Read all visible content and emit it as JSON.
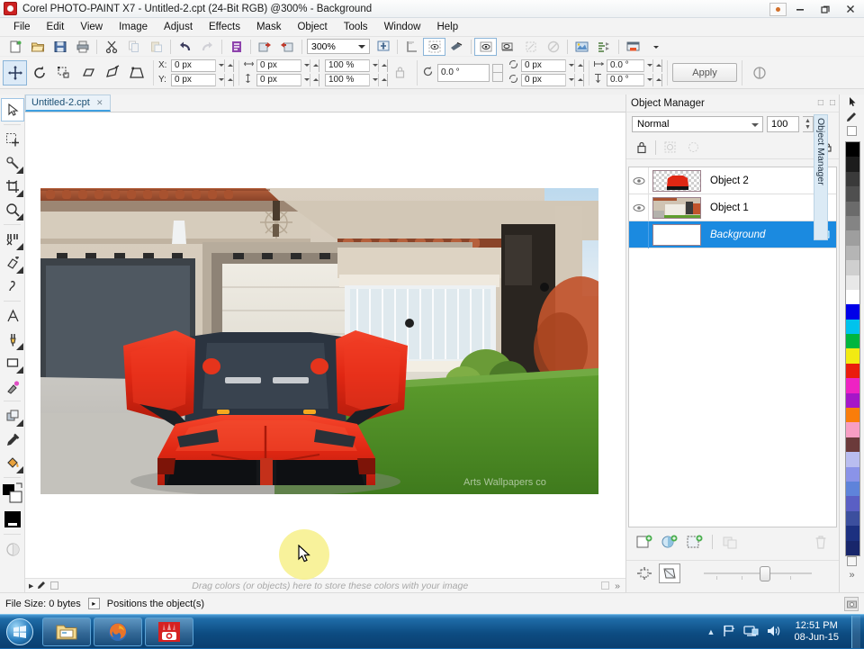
{
  "window": {
    "title": "Corel PHOTO-PAINT X7 - Untitled-2.cpt (24-Bit RGB) @300% - Background",
    "logo_icon": "corel-photopaint-logo",
    "account_icon": "user-account-icon",
    "minimize_label": "—",
    "restore_label": "❐",
    "close_label": "✕"
  },
  "menubar": {
    "items": [
      {
        "label": "File"
      },
      {
        "label": "Edit"
      },
      {
        "label": "View"
      },
      {
        "label": "Image"
      },
      {
        "label": "Adjust"
      },
      {
        "label": "Effects"
      },
      {
        "label": "Mask"
      },
      {
        "label": "Object"
      },
      {
        "label": "Tools"
      },
      {
        "label": "Window"
      },
      {
        "label": "Help"
      }
    ]
  },
  "toolbar": {
    "zoom_value": "300%",
    "items": [
      {
        "name": "new-document-button",
        "icon": "new-page-icon"
      },
      {
        "name": "open-button",
        "icon": "folder-open-icon"
      },
      {
        "name": "save-button",
        "icon": "floppy-disk-icon"
      },
      {
        "name": "print-button",
        "icon": "printer-icon"
      },
      {
        "name": "cut-button",
        "icon": "scissors-icon"
      },
      {
        "name": "copy-button",
        "icon": "copy-icon"
      },
      {
        "name": "paste-button",
        "icon": "paste-icon"
      },
      {
        "name": "undo-button",
        "icon": "undo-arrow-icon"
      },
      {
        "name": "redo-button",
        "icon": "redo-arrow-icon"
      },
      {
        "name": "import-button",
        "icon": "import-icon"
      },
      {
        "name": "export-button",
        "icon": "export-icon"
      },
      {
        "name": "export-to-web-button",
        "icon": "export-web-icon"
      },
      {
        "name": "zoom-levels-combo",
        "icon": "chevron-down-icon"
      },
      {
        "name": "fit-to-window-button",
        "icon": "fit-window-icon"
      },
      {
        "name": "full-screen-preview-button",
        "icon": "full-screen-icon"
      },
      {
        "name": "show-grid-button",
        "icon": "grid-icon"
      },
      {
        "name": "show-rulers-button",
        "icon": "ruler-icon"
      },
      {
        "name": "mask-overlay-button",
        "icon": "mask-overlay-icon"
      },
      {
        "name": "mask-marquee-button",
        "icon": "mask-marquee-icon"
      },
      {
        "name": "clip-mask-button",
        "icon": "clip-mask-icon"
      },
      {
        "name": "no-clip-button",
        "icon": "no-entry-icon"
      },
      {
        "name": "image-adjustment-lab-button",
        "icon": "adjust-lab-icon"
      },
      {
        "name": "object-manager-button",
        "icon": "layers-icon"
      },
      {
        "name": "application-launcher-button",
        "icon": "app-launcher-icon"
      },
      {
        "name": "launcher-dropdown-button",
        "icon": "chevron-down-icon"
      }
    ]
  },
  "propbar": {
    "tools": [
      {
        "name": "object-pick-tool",
        "icon": "move-cross-icon",
        "selected": true
      },
      {
        "name": "rotate-tool",
        "icon": "rotate-icon",
        "selected": false
      },
      {
        "name": "scale-tool",
        "icon": "scale-icon",
        "selected": false
      },
      {
        "name": "skew-tool",
        "icon": "skew-icon",
        "selected": false
      },
      {
        "name": "distort-tool",
        "icon": "distort-icon",
        "selected": false
      },
      {
        "name": "perspective-tool",
        "icon": "perspective-icon",
        "selected": false
      }
    ],
    "position": {
      "x_label": "X:",
      "x_value": "0 px",
      "y_label": "Y:",
      "y_value": "0 px"
    },
    "size": {
      "width_icon": "width-arrows-icon",
      "width_value": "0 px",
      "height_icon": "height-arrows-icon",
      "height_value": "0 px"
    },
    "scale": {
      "horizontal_value": "100 %",
      "vertical_value": "100 %"
    },
    "lock_ratio_icon": "lock-icon",
    "rotation": {
      "icon": "rotate-angle-icon",
      "value": "0.0 °"
    },
    "anchor": {
      "top_icon": "rotate-ccw-icon",
      "top_value": "0 px",
      "bottom_icon": "rotate-cw-icon",
      "bottom_value": "0 px"
    },
    "skew": {
      "h_icon": "skew-horizontal-icon",
      "h_value": "0.0 °",
      "v_icon": "skew-vertical-icon",
      "v_value": "0.0 °"
    },
    "apply_label": "Apply",
    "reset_icon": "reset-icon"
  },
  "toolbox": {
    "items": [
      {
        "name": "pick-tool",
        "icon": "arrow-cursor-icon",
        "selected": true,
        "flyout": false
      },
      {
        "name": "mask-transform-tool",
        "icon": "mask-transform-icon",
        "selected": false,
        "flyout": false
      },
      {
        "name": "mask-selection-tool",
        "icon": "magic-wand-icon",
        "selected": false,
        "flyout": true
      },
      {
        "name": "crop-tool",
        "icon": "crop-icon",
        "selected": false,
        "flyout": true
      },
      {
        "name": "zoom-tool",
        "icon": "magnifier-icon",
        "selected": false,
        "flyout": true
      },
      {
        "name": "smart-cutout-tool",
        "icon": "cutout-lab-icon",
        "selected": false,
        "flyout": true
      },
      {
        "name": "eraser-tool",
        "icon": "eraser-icon",
        "selected": false,
        "flyout": true
      },
      {
        "name": "smear-tool",
        "icon": "smear-icon",
        "selected": false,
        "flyout": false
      },
      {
        "name": "text-tool",
        "icon": "text-a-icon",
        "selected": false,
        "flyout": false
      },
      {
        "name": "paint-tool",
        "icon": "paintbrush-icon",
        "selected": false,
        "flyout": true
      },
      {
        "name": "rectangle-shape-tool",
        "icon": "rectangle-icon",
        "selected": false,
        "flyout": true
      },
      {
        "name": "clone-tool",
        "icon": "clone-stamp-icon",
        "selected": false,
        "flyout": false
      },
      {
        "name": "object-transparency-tool",
        "icon": "transparency-icon",
        "selected": false,
        "flyout": true
      },
      {
        "name": "eyedropper-tool",
        "icon": "eyedropper-icon",
        "selected": false,
        "flyout": false
      },
      {
        "name": "fill-tool",
        "icon": "paint-bucket-icon",
        "selected": false,
        "flyout": true
      }
    ],
    "color_swatches": {
      "foreground": "#000000",
      "background": "#ffffff",
      "fill": "#000000",
      "swap_icon": "swap-colors-icon"
    },
    "quick_mask_icon": "quick-mask-icon"
  },
  "document": {
    "tab_label": "Untitled-2.cpt",
    "tab_close_icon": "close-icon",
    "pick_icon": "arrow-cursor-icon",
    "watermark": "Arts Wallpapers co"
  },
  "dropstrip": {
    "hint": "Drag colors (or objects) here to store these colors with your image",
    "left_icon": "arrow-right-icon",
    "eyedropper_icon": "eyedropper-icon",
    "expand_icon": "chevron-double-right-icon"
  },
  "docker": {
    "title": "Object Manager",
    "vertical_tab_label": "Object Manager",
    "minimize_icon": "minimize-icon",
    "close_icon": "close-icon",
    "menu_icon": "docker-menu-icon",
    "blend_mode": "Normal",
    "opacity_value": "100",
    "opacity_unit": "%",
    "lock_buttons": [
      {
        "name": "lock-transparency-button",
        "icon": "padlock-icon",
        "disabled": false
      },
      {
        "name": "edit-across-layers-button",
        "icon": "layers-edit-icon",
        "disabled": true
      },
      {
        "name": "show-object-marquee-button",
        "icon": "marquee-icon",
        "disabled": true
      },
      {
        "name": "lock-object-button",
        "icon": "lock-object-icon",
        "disabled": false
      }
    ],
    "layers": [
      {
        "name": "Object 2",
        "visible": true,
        "active": false,
        "thumb": "checkerboard-car",
        "locked": false
      },
      {
        "name": "Object 1",
        "visible": true,
        "active": false,
        "thumb": "house-photo",
        "locked": false
      },
      {
        "name": "Background",
        "visible": false,
        "active": true,
        "thumb": "white",
        "locked": true
      }
    ],
    "bottom_buttons": [
      {
        "name": "new-object-button",
        "icon": "new-object-icon",
        "disabled": false
      },
      {
        "name": "new-lens-button",
        "icon": "new-lens-icon",
        "disabled": false
      },
      {
        "name": "new-object-from-mask-button",
        "icon": "object-from-mask-icon",
        "disabled": false
      },
      {
        "name": "combine-objects-button",
        "icon": "combine-icon",
        "disabled": true
      },
      {
        "name": "delete-object-button",
        "icon": "trash-icon",
        "disabled": true
      }
    ],
    "bottom_buttons2": [
      {
        "name": "object-properties-button",
        "icon": "object-properties-icon",
        "disabled": false
      },
      {
        "name": "object-transparency-button",
        "icon": "object-transparency-icon",
        "disabled": false
      }
    ]
  },
  "palette": {
    "pick_icon": "arrow-cursor-icon",
    "eyedropper_icon": "eyedropper-icon",
    "no-color_icon": "no-color-icon",
    "scroll_up_icon": "chevron-up-icon",
    "expand_icon": "chevron-double-right-icon",
    "colors": [
      "#000000",
      "#1c1c1c",
      "#3a3a3a",
      "#4f4f4f",
      "#6b6b6b",
      "#848484",
      "#9e9e9e",
      "#b5b5b5",
      "#cfcfcf",
      "#e8e8e8",
      "#ffffff",
      "#0000e8",
      "#00c3ed",
      "#00b63e",
      "#f2eb12",
      "#ea1c0d",
      "#ee22c3",
      "#a516c8",
      "#f97d0a",
      "#f89ec3",
      "#6b3a3a",
      "#b9bdf0",
      "#8a93e8",
      "#5f83da",
      "#5a5fc4",
      "#3c4f9e",
      "#1c3080",
      "#18266b"
    ]
  },
  "statusbar": {
    "file_size_label": "File Size: 0 bytes",
    "expander_icon": "arrow-right-icon",
    "hint": "Positions the object(s)",
    "right_icon": "snapshot-icon"
  },
  "taskbar": {
    "start_icon": "windows-start-orb",
    "items": [
      {
        "name": "taskbar-item-explorer",
        "icon": "folder-icon"
      },
      {
        "name": "taskbar-item-firefox",
        "icon": "firefox-icon"
      },
      {
        "name": "taskbar-item-photopaint",
        "icon": "photopaint-icon"
      }
    ],
    "tray": {
      "show_hidden_icon": "chevron-up-icon",
      "action_center_icon": "flag-icon",
      "network_icon": "network-icon",
      "volume_icon": "speaker-icon",
      "time": "12:51 PM",
      "date": "08-Jun-15"
    }
  },
  "colors": {
    "accent": "#1b8ae0",
    "title_bg": "#fdfdfd",
    "chrome": "#f3f3f3",
    "taskbar": "#0d4c82"
  }
}
